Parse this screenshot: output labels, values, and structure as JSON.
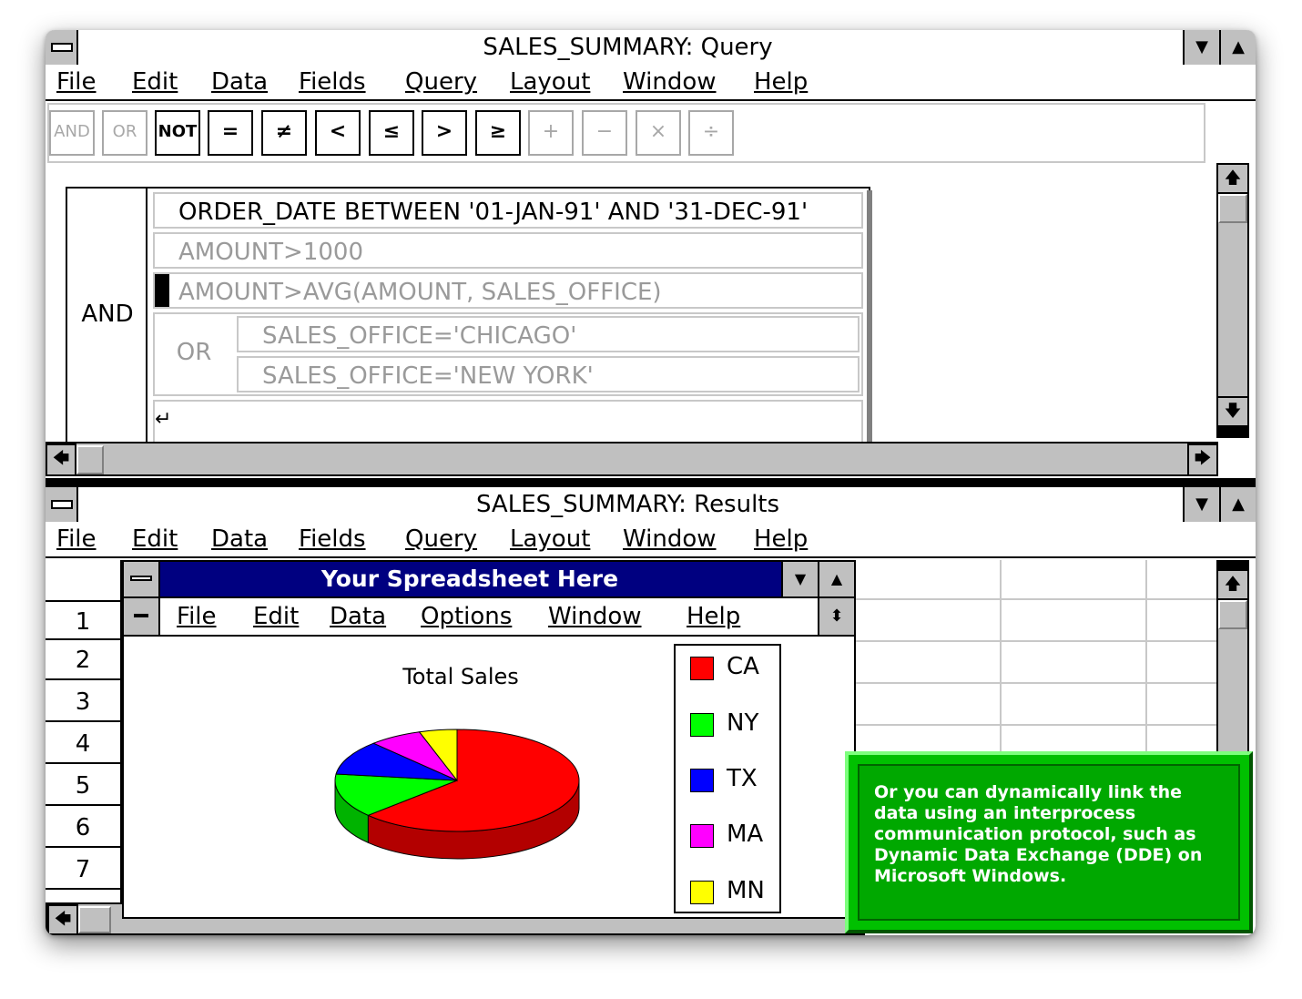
{
  "query_window": {
    "title": "SALES_SUMMARY: Query",
    "menu": [
      "File",
      "Edit",
      "Data",
      "Fields",
      "Query",
      "Layout",
      "Window",
      "Help"
    ],
    "toolbar": [
      "AND",
      "OR",
      "NOT",
      "=",
      "≠",
      "<",
      "≤",
      ">",
      "≥",
      "+",
      "−",
      "×",
      "÷"
    ],
    "group_label": "AND",
    "criteria": [
      "ORDER_DATE BETWEEN '01-JAN-91' AND '31-DEC-91'",
      "AMOUNT>1000",
      "AMOUNT>AVG(AMOUNT, SALES_OFFICE)"
    ],
    "or_label": "OR",
    "or_criteria": [
      "SALES_OFFICE='CHICAGO'",
      "SALES_OFFICE='NEW YORK'"
    ],
    "new_row_symbol": "↵"
  },
  "results_window": {
    "title": "SALES_SUMMARY: Results",
    "menu": [
      "File",
      "Edit",
      "Data",
      "Fields",
      "Query",
      "Layout",
      "Window",
      "Help"
    ],
    "row_numbers": [
      "1",
      "2",
      "3",
      "4",
      "5",
      "6",
      "7"
    ]
  },
  "spreadsheet": {
    "title": "Your Spreadsheet Here",
    "menu": [
      "File",
      "Edit",
      "Data",
      "Options",
      "Window",
      "Help"
    ]
  },
  "chart_data": {
    "type": "pie",
    "title": "Total Sales",
    "categories": [
      "CA",
      "NY",
      "TX",
      "MA",
      "MN"
    ],
    "values": [
      63,
      14,
      11,
      7,
      5
    ],
    "colors": [
      "#ff0000",
      "#00ff00",
      "#0000ff",
      "#ff00ff",
      "#ffff00"
    ],
    "legend_position": "right"
  },
  "callout": {
    "text": "Or you can dynamically link the data using an interprocess communication protocol, such as Dynamic Data Exchange (DDE) on Microsoft Windows."
  },
  "icons": {
    "minimize": "down-triangle-icon",
    "maximize": "up-triangle-icon",
    "scroll_up": "up-arrow-icon",
    "scroll_down": "down-arrow-icon",
    "scroll_left": "left-arrow-icon",
    "scroll_right": "right-arrow-icon"
  }
}
